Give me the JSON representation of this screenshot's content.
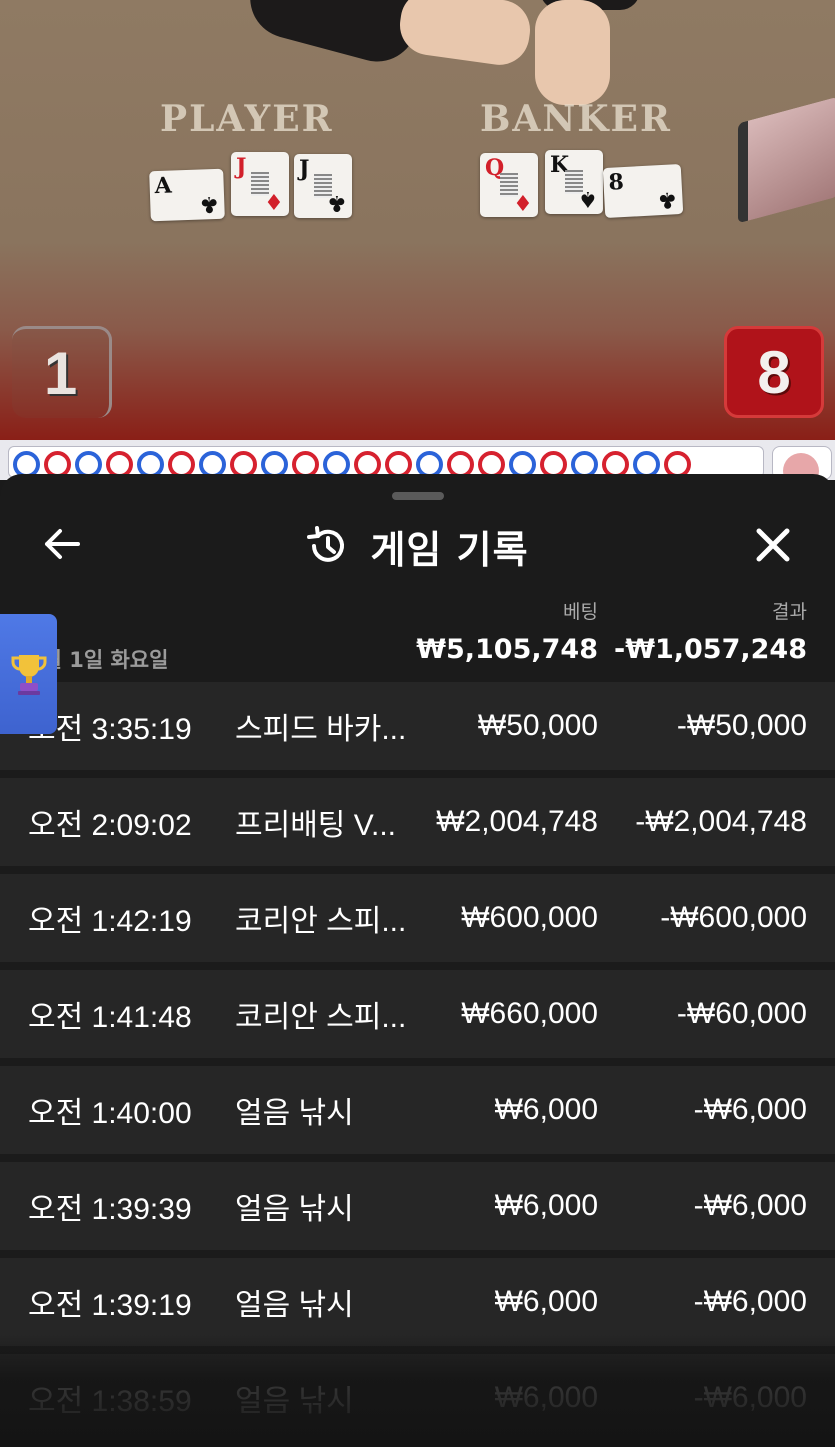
{
  "video": {
    "player_label": "PLAYER",
    "banker_label": "BANKER",
    "player_score": "1",
    "banker_score": "8",
    "player_cards": [
      {
        "rank": "A",
        "suit": "♣",
        "color": "black"
      },
      {
        "rank": "J",
        "suit": "♦",
        "color": "red"
      },
      {
        "rank": "J",
        "suit": "♣",
        "color": "black"
      }
    ],
    "banker_cards": [
      {
        "rank": "Q",
        "suit": "♦",
        "color": "red"
      },
      {
        "rank": "K",
        "suit": "♠",
        "color": "black"
      },
      {
        "rank": "8",
        "suit": "♣",
        "color": "black"
      }
    ]
  },
  "road": {
    "beads": [
      "b",
      "r",
      "b",
      "r",
      "b",
      "r",
      "b",
      "r",
      "b",
      "r",
      "b",
      "r",
      "r",
      "b",
      "r",
      "r",
      "b",
      "r",
      "b",
      "r",
      "b",
      "r"
    ]
  },
  "panel": {
    "title": "게임 기록",
    "icons": {
      "back": "arrow-left-icon",
      "history": "history-icon",
      "close": "close-icon",
      "trophy": "trophy-icon"
    },
    "bet_header": "베팅",
    "result_header": "결과",
    "date": "9월 1일 화요일",
    "total_bet": "₩5,105,748",
    "total_result": "-₩1,057,248",
    "rows": [
      {
        "time": "오전 3:35:19",
        "game": "스피드 바카...",
        "bet": "₩50,000",
        "result": "-₩50,000"
      },
      {
        "time": "오전 2:09:02",
        "game": "프리배팅 V...",
        "bet": "₩2,004,748",
        "result": "-₩2,004,748"
      },
      {
        "time": "오전 1:42:19",
        "game": "코리안 스피...",
        "bet": "₩600,000",
        "result": "-₩600,000"
      },
      {
        "time": "오전 1:41:48",
        "game": "코리안 스피...",
        "bet": "₩660,000",
        "result": "-₩60,000"
      },
      {
        "time": "오전 1:40:00",
        "game": "얼음 낚시",
        "bet": "₩6,000",
        "result": "-₩6,000"
      },
      {
        "time": "오전 1:39:39",
        "game": "얼음 낚시",
        "bet": "₩6,000",
        "result": "-₩6,000"
      },
      {
        "time": "오전 1:39:19",
        "game": "얼음 낚시",
        "bet": "₩6,000",
        "result": "-₩6,000"
      },
      {
        "time": "오전 1:38:59",
        "game": "얼음 낚시",
        "bet": "₩6,000",
        "result": "-₩6,000"
      }
    ]
  },
  "colors": {
    "panel_bg": "#1b1b1b",
    "row_bg": "#262626",
    "banker_red": "#b0131a",
    "road_blue": "#2b63d9",
    "road_red": "#d6212f",
    "trophy_tab": "#4f79e6"
  }
}
